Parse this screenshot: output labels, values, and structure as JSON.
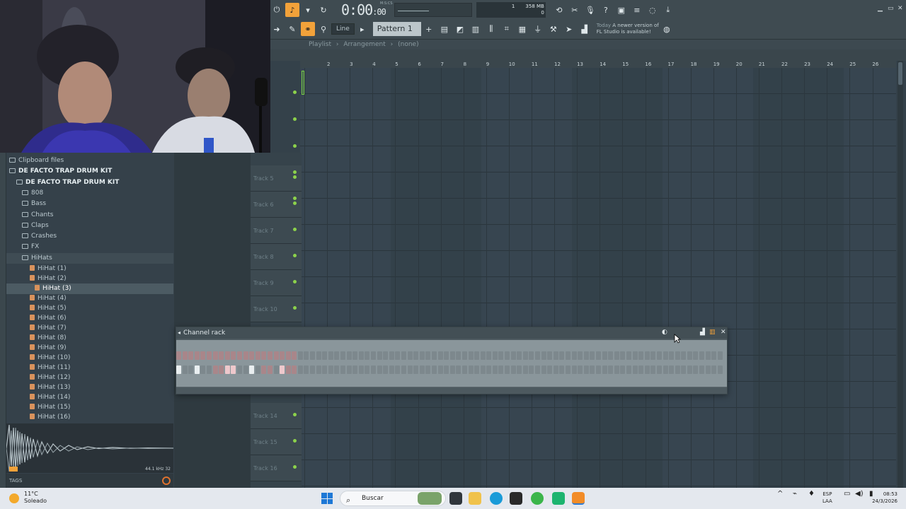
{
  "toolbar": {
    "time": "0:00",
    "time_small": ":00",
    "time_label": "M:S:CS",
    "cpu_value": "1",
    "memory": "358 MB",
    "voices": "0",
    "snap_mode": "Line",
    "pattern": "Pattern 1",
    "hint_today": "Today",
    "hint_text": "A newer version of",
    "hint_text2": "FL Studio is available!"
  },
  "playlist": {
    "title": "Playlist",
    "arrangement": "Arrangement",
    "selection": "(none)",
    "ruler": [
      "2",
      "3",
      "4",
      "5",
      "6",
      "7",
      "8",
      "9",
      "10",
      "11",
      "12",
      "13",
      "14",
      "15",
      "16",
      "17",
      "18",
      "19",
      "20",
      "21",
      "22",
      "23",
      "24",
      "25",
      "26"
    ],
    "tracks": [
      {
        "name": "Track 5"
      },
      {
        "name": "Track 6"
      },
      {
        "name": "Track 7"
      },
      {
        "name": "Track 8"
      },
      {
        "name": "Track 9"
      },
      {
        "name": "Track 10"
      },
      {
        "name": "Track 14"
      },
      {
        "name": "Track 15"
      },
      {
        "name": "Track 16"
      }
    ]
  },
  "browser": {
    "items": [
      {
        "label": "Clipboard files",
        "type": "folder",
        "indent": 0
      },
      {
        "label": "DE FACTO TRAP DRUM KIT",
        "type": "folder",
        "indent": 0,
        "bold": true
      },
      {
        "label": "DE FACTO TRAP DRUM KIT",
        "type": "folder",
        "indent": 1,
        "bold": true
      },
      {
        "label": "808",
        "type": "folder",
        "indent": 2
      },
      {
        "label": "Bass",
        "type": "folder",
        "indent": 2
      },
      {
        "label": "Chants",
        "type": "folder",
        "indent": 2
      },
      {
        "label": "Claps",
        "type": "folder",
        "indent": 2
      },
      {
        "label": "Crashes",
        "type": "folder",
        "indent": 2
      },
      {
        "label": "FX",
        "type": "folder",
        "indent": 2
      },
      {
        "label": "HiHats",
        "type": "folder",
        "indent": 2,
        "open": true
      },
      {
        "label": "HiHat (1)",
        "type": "file"
      },
      {
        "label": "HiHat (2)",
        "type": "file"
      },
      {
        "label": "HiHat (3)",
        "type": "file",
        "selected": true
      },
      {
        "label": "HiHat (4)",
        "type": "file"
      },
      {
        "label": "HiHat (5)",
        "type": "file"
      },
      {
        "label": "HiHat (6)",
        "type": "file"
      },
      {
        "label": "HiHat (7)",
        "type": "file"
      },
      {
        "label": "HiHat (8)",
        "type": "file"
      },
      {
        "label": "HiHat (9)",
        "type": "file"
      },
      {
        "label": "HiHat (10)",
        "type": "file"
      },
      {
        "label": "HiHat (11)",
        "type": "file"
      },
      {
        "label": "HiHat (12)",
        "type": "file"
      },
      {
        "label": "HiHat (13)",
        "type": "file"
      },
      {
        "label": "HiHat (14)",
        "type": "file"
      },
      {
        "label": "HiHat (15)",
        "type": "file"
      },
      {
        "label": "HiHat (16)",
        "type": "file"
      }
    ],
    "wave_info": "44.1 kHz 32",
    "tags_label": "TAGS"
  },
  "channel_rack": {
    "title": "Channel rack",
    "row1": "rrrrrrrrrrrrrrrrrrrr",
    "row2": "oggoggrrppggogrrgprr"
  },
  "taskbar": {
    "temp": "11°C",
    "weather": "Soleado",
    "search": "Buscar",
    "lang": "ESP",
    "lang2": "LAA",
    "time": "08:53",
    "date": "24/3/2026"
  },
  "colors": {
    "accent": "#f2a23a",
    "track_dot": "#8cd24b",
    "file_icon": "#d9925c"
  }
}
